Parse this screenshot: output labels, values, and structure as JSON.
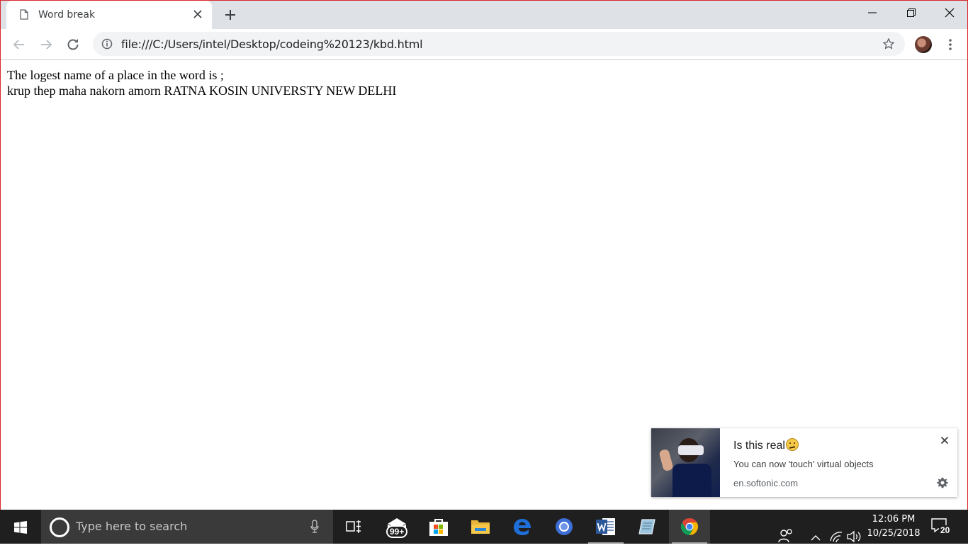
{
  "browser": {
    "tab_title": "Word break",
    "url": "file:///C:/Users/intel/Desktop/codeing%20123/kbd.html"
  },
  "page": {
    "line1": "The logest name of a place in the word is ;",
    "line2": "krup thep maha nakorn amorn RATNA KOSIN UNIVERSTY NEW DELHI"
  },
  "notification": {
    "title": "Is this real",
    "message": "You can now 'touch' virtual objects",
    "source": "en.softonic.com"
  },
  "taskbar": {
    "search_placeholder": "Type here to search",
    "mail_badge": "99+",
    "time": "12:06 PM",
    "date": "10/25/2018",
    "notification_count": "20"
  },
  "colors": {
    "window_border": "#d9262c",
    "tabstrip": "#dee1e6",
    "omnibox": "#f1f3f4",
    "taskbar": "#1f1f1f"
  },
  "icons": [
    "page-icon",
    "close-icon",
    "plus-icon",
    "minimize-icon",
    "restore-icon",
    "window-close-icon",
    "back-arrow-icon",
    "forward-arrow-icon",
    "reload-icon",
    "info-icon",
    "star-icon",
    "avatar",
    "kebab-menu-icon",
    "gear-icon",
    "windows-logo-icon",
    "cortana-icon",
    "microphone-icon",
    "task-view-icon",
    "mail-icon",
    "store-icon",
    "file-explorer-icon",
    "edge-icon",
    "chrome-canary-icon",
    "word-icon",
    "notepad-icon",
    "chrome-icon",
    "people-icon",
    "chevron-up-icon",
    "wifi-icon",
    "speaker-icon",
    "action-center-icon"
  ]
}
